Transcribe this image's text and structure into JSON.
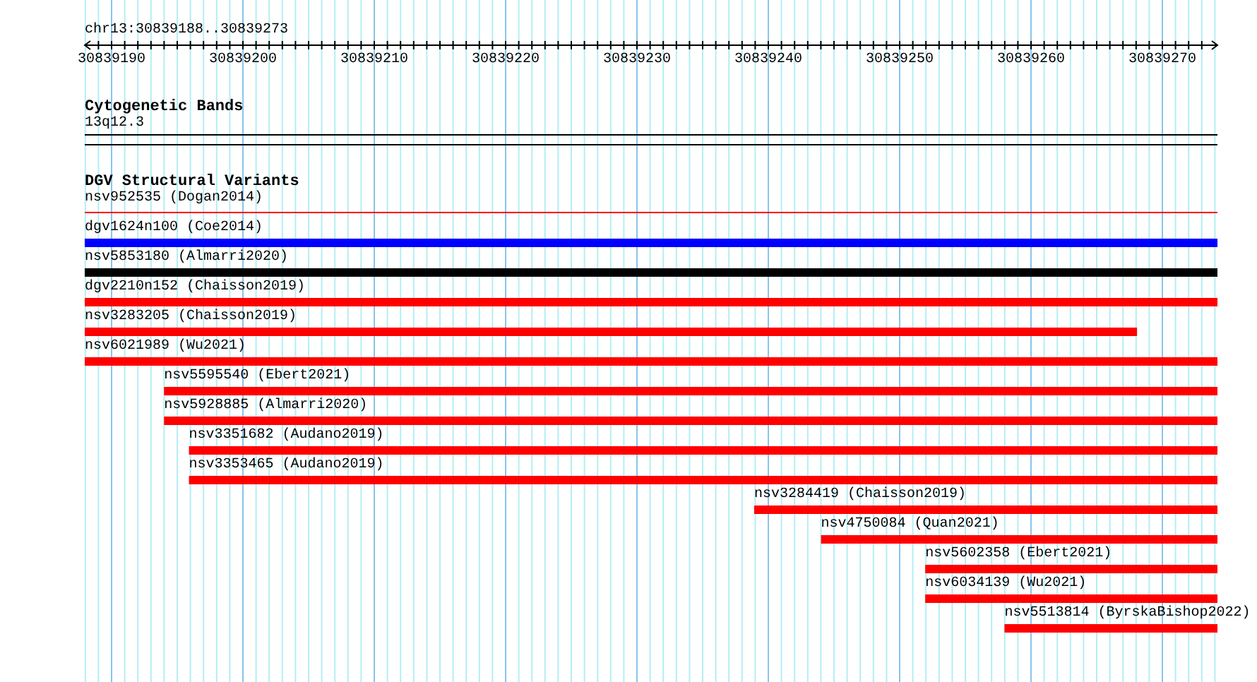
{
  "ruler": {
    "location": "chr13:30839188..30839273",
    "ticks": [
      "30839190",
      "30839200",
      "30839210",
      "30839220",
      "30839230",
      "30839240",
      "30839250",
      "30839260",
      "30839270"
    ]
  },
  "tracks": [
    {
      "title": "Cytogenetic Bands",
      "kind": "bands",
      "features": [
        {
          "label": "13q12.3"
        }
      ]
    },
    {
      "title": "DGV Structural Variants",
      "kind": "variants",
      "features": [
        {
          "label": "nsv952535 (Dogan2014)",
          "kind": "thin",
          "level": 1,
          "color": "#ff0000"
        },
        {
          "label": "dgv1624n100 (Coe2014)",
          "kind": "thick",
          "level": 1,
          "color": "#0000ff"
        },
        {
          "label": "nsv5853180 (Almarri2020)",
          "kind": "thick",
          "level": 1,
          "color": "#000000"
        },
        {
          "label": "dgv2210n152 (Chaisson2019)",
          "kind": "thick",
          "level": 1,
          "color": "#ff0000"
        },
        {
          "label": "nsv3283205 (Chaisson2019)",
          "kind": "partial",
          "level": 0.929,
          "color": "#ff0000"
        },
        {
          "label": "nsv6021989 (Wu2021)",
          "kind": "thick",
          "level": 1,
          "color": "#ff0000"
        },
        {
          "label": "nsv5595540 (Ebert2021)",
          "kind": "thick",
          "level": 0.93,
          "color": "#ff0000"
        },
        {
          "label": "nsv5928885 (Almarri2020)",
          "kind": "thick",
          "level": 0.93,
          "color": "#ff0000"
        },
        {
          "label": "nsv3351682 (Audano2019)",
          "kind": "thick",
          "level": 0.908,
          "color": "#ff0000"
        },
        {
          "label": "nsv3353465 (Audano2019)",
          "kind": "thick",
          "level": 0.908,
          "color": "#ff0000"
        },
        {
          "label": "nsv3284419 (Chaisson2019)",
          "kind": "thick",
          "level": 0.409,
          "color": "#ff0000"
        },
        {
          "label": "nsv4750084 (Quan2021)",
          "kind": "thick",
          "level": 0.35,
          "color": "#ff0000"
        },
        {
          "label": "nsv5602358 (Ebert2021)",
          "kind": "thick",
          "level": 0.258,
          "color": "#ff0000"
        },
        {
          "label": "nsv6034139 (Wu2021)",
          "kind": "thick",
          "level": 0.258,
          "color": "#ff0000"
        },
        {
          "label": "nsv5513814 (ByrskaBishop2022)",
          "kind": "thick",
          "level": 0.188,
          "color": "#ff0000"
        }
      ]
    }
  ]
}
